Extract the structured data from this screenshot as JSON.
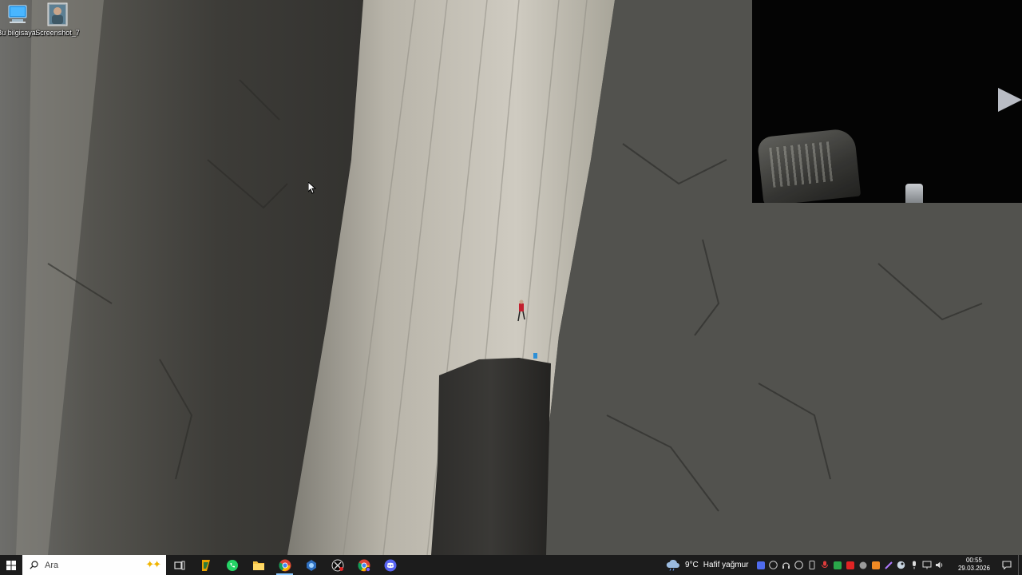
{
  "desktop": {
    "icons": [
      {
        "label": "Bu bilgisayar",
        "icon": "this-pc-icon"
      },
      {
        "label": "Screenshot_7",
        "icon": "image-file-icon"
      }
    ]
  },
  "taskbar": {
    "search_placeholder": "Ara",
    "apps": [
      {
        "name": "task-view-icon"
      },
      {
        "name": "onenote-like-app-icon"
      },
      {
        "name": "whatsapp-icon"
      },
      {
        "name": "file-explorer-icon"
      },
      {
        "name": "chrome-icon"
      },
      {
        "name": "settings-app-icon"
      },
      {
        "name": "recorder-app-icon"
      },
      {
        "name": "chrome-profile-icon"
      },
      {
        "name": "discord-icon"
      }
    ],
    "weather": {
      "temp": "9°C",
      "condition": "Hafif yağmur",
      "icon": "cloud-rain-icon"
    },
    "clock": {
      "time": "00:55",
      "date": "29.03.2026"
    }
  },
  "colors": {
    "taskbar_bg": "#1c1c1c",
    "active_indicator": "#8cc8ff",
    "whatsapp": "#25d366",
    "discord": "#5865f2"
  }
}
